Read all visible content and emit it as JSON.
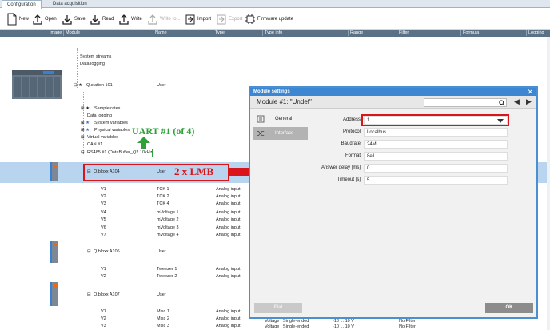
{
  "tabs": [
    {
      "label": "Configuration"
    },
    {
      "label": "Data acquisition"
    }
  ],
  "toolbar": {
    "new": "New",
    "open": "Open",
    "save": "Save",
    "read": "Read",
    "write": "Write",
    "write_to": "Write to...",
    "import": "Import",
    "export": "Export",
    "firmware": "Firmware update"
  },
  "columns": {
    "image": "Image",
    "module": "Module",
    "name": "Name",
    "type": "Type",
    "typeinfo": "Type info",
    "range": "Range",
    "filter": "Filter",
    "formula": "Formula",
    "logging": "Logging"
  },
  "tree": {
    "system_streams": "System streams",
    "data_logging": "Data logging",
    "station": "Q.station 101",
    "station_name": "User",
    "sample_rates": "Sample rates",
    "data_logging2": "Data logging",
    "system_variables": "System variables",
    "physical_variables": "Physical variables",
    "virtual_variables": "Virtual variables",
    "can1": "CAN #1",
    "rs485": "RS485 #1 (DataBuffer_Q2 10kHz)",
    "a104": "Q.bloxx A104",
    "a104_name": "User",
    "a104_ch": [
      {
        "ch": "V1",
        "name": "TCK 1",
        "type": "Analog input"
      },
      {
        "ch": "V2",
        "name": "TCK 2",
        "type": "Analog input"
      },
      {
        "ch": "V3",
        "name": "TCK 4",
        "type": "Analog input"
      },
      {
        "ch": "V4",
        "name": "mVoltage 1",
        "type": "Analog input"
      },
      {
        "ch": "V5",
        "name": "mVoltage 2",
        "type": "Analog input"
      },
      {
        "ch": "V6",
        "name": "mVoltage 3",
        "type": "Analog input"
      },
      {
        "ch": "V7",
        "name": "mVoltage 4",
        "type": "Analog input"
      }
    ],
    "a106": "Q.bloxx A106",
    "a106_name": "User",
    "a106_ch": [
      {
        "ch": "V1",
        "name": "Tweezer 1",
        "type": "Analog input"
      },
      {
        "ch": "V2",
        "name": "Tweezer 2",
        "type": "Analog input"
      }
    ],
    "a107": "Q.bloxx A107",
    "a107_name": "User",
    "a107_ch": [
      {
        "ch": "V1",
        "name": "Misc 1",
        "type": "Analog input",
        "info": "Voltage , Single-ended",
        "range": "-10 ... 10 V",
        "filter": "No Filter"
      },
      {
        "ch": "V2",
        "name": "Misc 2",
        "type": "Analog input",
        "info": "Voltage , Single-ended",
        "range": "-10 ... 10 V",
        "filter": "No Filter"
      },
      {
        "ch": "V3",
        "name": "Misc 3",
        "type": "Analog input",
        "info": "Voltage , Single-ended",
        "range": "-10 ... 10 V",
        "filter": "No Filter"
      }
    ]
  },
  "annotations": {
    "uart": "UART #1 (of 4)",
    "lmb": "2 x LMB"
  },
  "dialog": {
    "title": "Module settings",
    "module": "Module #1: \"Undef\"",
    "nav": {
      "general": "General",
      "interface": "Interface"
    },
    "fields": [
      {
        "label": "Address",
        "value": "1"
      },
      {
        "label": "Protocol",
        "value": "Localbus"
      },
      {
        "label": "Baudrate",
        "value": "24M"
      },
      {
        "label": "Format",
        "value": "8e1"
      },
      {
        "label": "Answer delay [ms]",
        "value": "0"
      },
      {
        "label": "Timeout [s]",
        "value": "5"
      }
    ],
    "flat": "Flat",
    "ok": "OK"
  },
  "colors": {
    "accent": "#3d86d1",
    "annotation_red": "#d9141a",
    "annotation_green": "#2fa13a",
    "selection": "#b9d4ee"
  }
}
